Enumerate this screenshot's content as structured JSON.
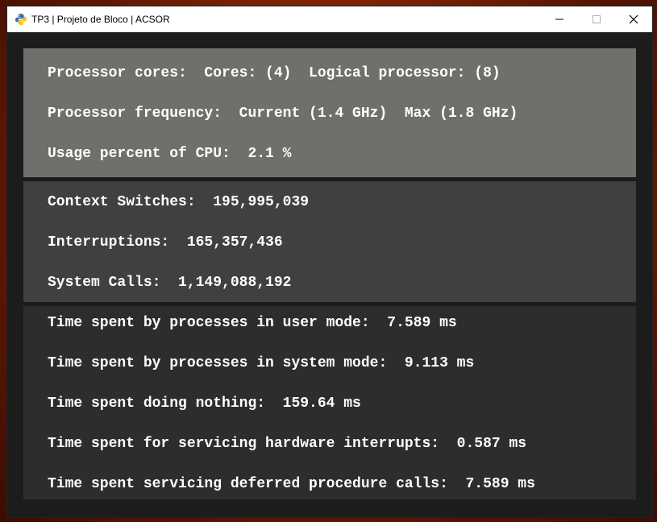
{
  "window": {
    "title": "TP3 | Projeto de Bloco | ACSOR",
    "icon": "python-icon"
  },
  "titlebar_buttons": {
    "minimize_icon": "minimize-icon",
    "maximize_icon": "maximize-icon",
    "close_icon": "close-icon"
  },
  "cpu_panel": {
    "cores_line": "Processor cores:  Cores: (4)  Logical processor: (8)",
    "frequency_line": "Processor frequency:  Current (1.4 GHz)  Max (1.8 GHz)",
    "usage_line": "Usage percent of CPU:  2.1 %"
  },
  "stats_panel": {
    "context_switches_line": "Context Switches:  195,995,039",
    "interruptions_line": "Interruptions:  165,357,436",
    "system_calls_line": "System Calls:  1,149,088,192"
  },
  "times_panel": {
    "user_mode_line": "Time spent by processes in user mode:  7.589 ms",
    "system_mode_line": "Time spent by processes in system mode:  9.113 ms",
    "idle_line": "Time spent doing nothing:  159.64 ms",
    "hw_interrupts_line": "Time spent for servicing hardware interrupts:  0.587 ms",
    "dpc_line": "Time spent servicing deferred procedure calls:  7.589 ms"
  },
  "colors": {
    "cpu_panel_bg": "#6f6f6b",
    "stats_panel_bg": "#404040",
    "times_panel_bg": "#2d2d2d",
    "text": "#ffffff"
  }
}
